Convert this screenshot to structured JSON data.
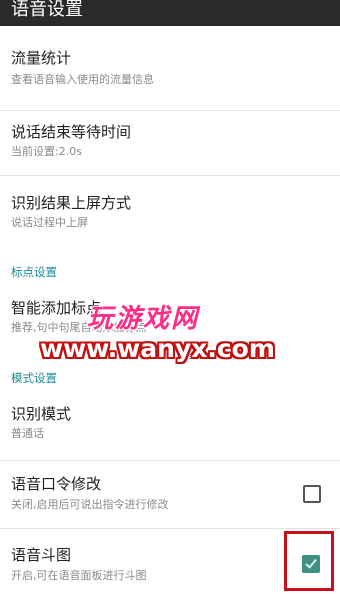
{
  "header": {
    "title": "语音设置"
  },
  "items": {
    "traffic": {
      "title": "流量统计",
      "subtitle": "查看语音输入使用的流量信息"
    },
    "wait_time": {
      "title": "说话结束等待时间",
      "subtitle": "当前设置:2.0s"
    },
    "result_mode": {
      "title": "识别结果上屏方式",
      "subtitle": "说话过程中上屏"
    },
    "smart_punct": {
      "title": "智能添加标点",
      "subtitle": "推荐,句中句尾自动添加标点"
    },
    "recog_mode": {
      "title": "识别模式",
      "subtitle": "普通话"
    },
    "voice_cmd": {
      "title": "语音口令修改",
      "subtitle": "关闭,启用后可说出指令进行修改",
      "checked": false
    },
    "voice_fight": {
      "title": "语音斗图",
      "subtitle": "开启,可在语音面板进行斗图",
      "checked": true
    }
  },
  "categories": {
    "punct": "标点设置",
    "mode": "模式设置"
  },
  "watermark": {
    "top": "玩游戏网",
    "bottom": "www.wanyx.com"
  },
  "colors": {
    "appbar": "#2a2a2a",
    "category": "#1a8c95",
    "checkbox_checked": "#3f8f83",
    "highlight": "#c8101b"
  }
}
